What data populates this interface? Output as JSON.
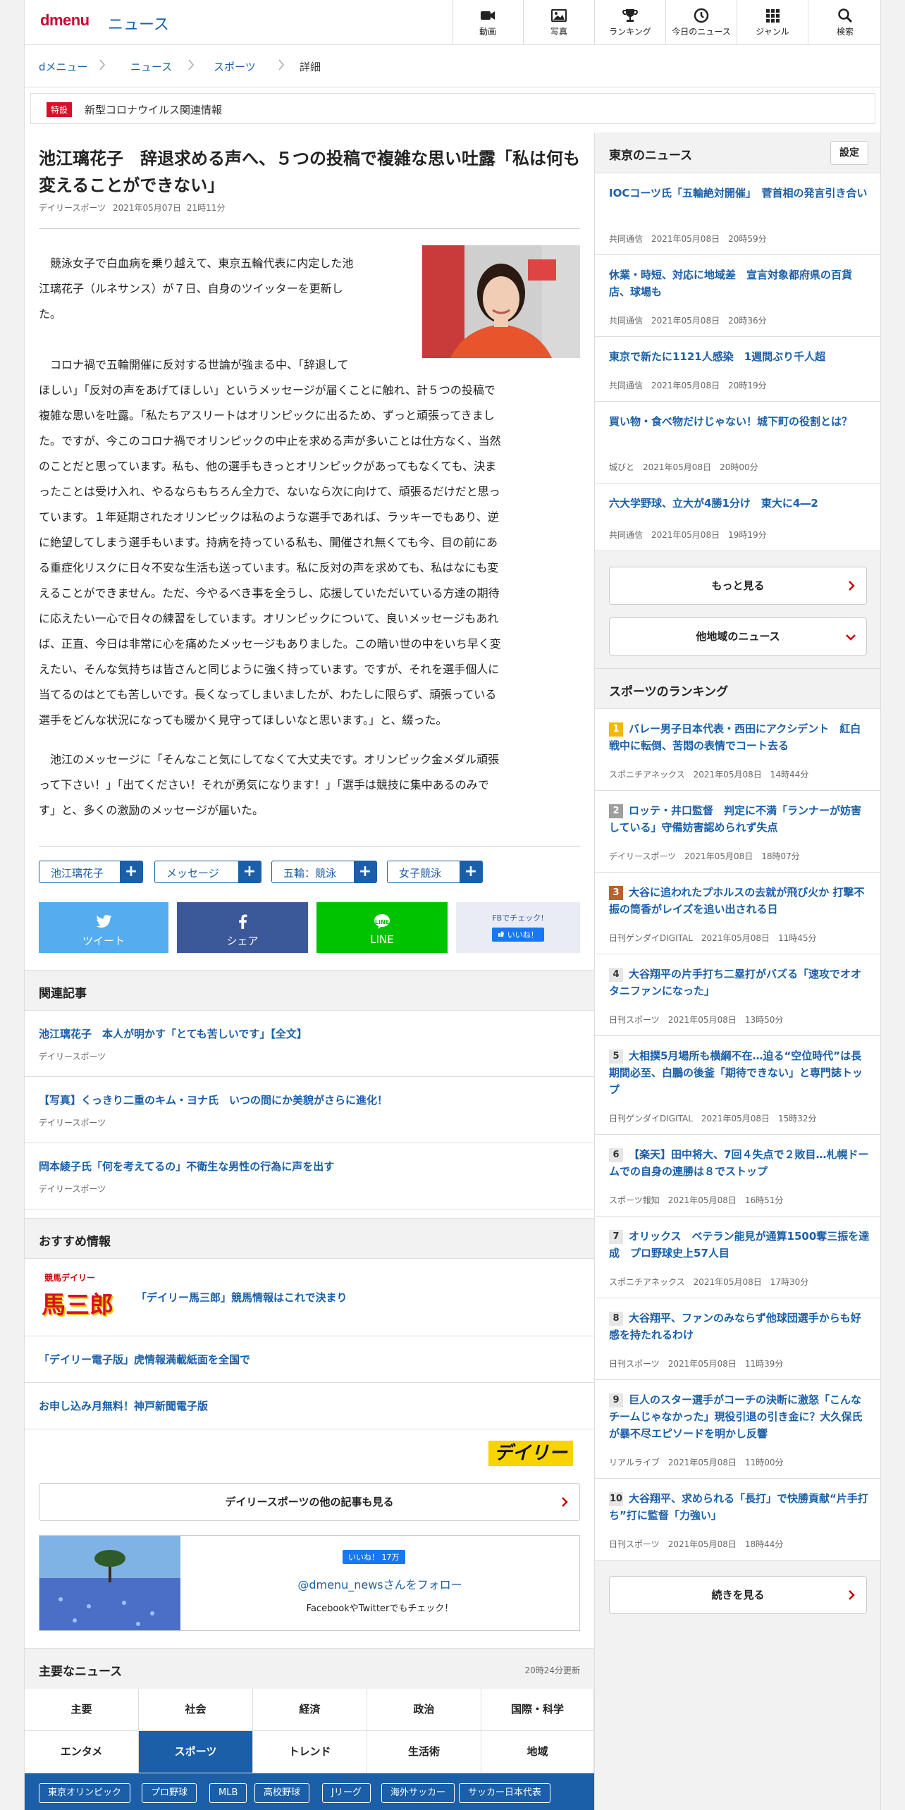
{
  "header": {
    "logo": "dmenu",
    "title": "ニュース",
    "nav": [
      "動画",
      "写真",
      "ランキング",
      "今日のニュース",
      "ジャンル",
      "検索"
    ]
  },
  "breadcrumb": [
    "dメニュー",
    "ニュース",
    "スポーツ",
    "詳細"
  ],
  "special": {
    "tag": "特設",
    "text": "新型コロナウイルス関連情報"
  },
  "article": {
    "title": "池江璃花子　辞退求める声へ、５つの投稿で複雑な思い吐露「私は何も変えることができない」",
    "source": "デイリースポーツ",
    "date": "2021年05月07日",
    "time": "21時11分",
    "paragraphs": [
      [
        "競泳女子で白血病を乗り越えて、東京五輪代表に内定した池",
        "江璃花子（ルネサンス）が７日、自身のツイッターを更新し",
        "た。"
      ],
      [
        "コロナ禍で五輪開催に反対する世論が強まる中、「辞退して",
        "ほしい」「反対の声をあげてほしい」というメッセージが届くことに触れ、計５つの投稿で",
        "複雑な思いを吐露。「私たちアスリートはオリンピックに出るため、ずっと頑張ってきまし",
        "た。ですが、今このコロナ禍でオリンピックの中止を求める声が多いことは仕方なく、当然",
        "のことだと思っています。私も、他の選手もきっとオリンピックがあってもなくても、決ま",
        "ったことは受け入れ、やるならもちろん全力で、ないなら次に向けて、頑張るだけだと思っ",
        "ています。１年延期されたオリンピックは私のような選手であれば、ラッキーでもあり、逆",
        "に絶望してしまう選手もいます。持病を持っている私も、開催され無くても今、目の前にあ",
        "る重症化リスクに日々不安な生活も送っています。私に反対の声を求めても、私はなにも変",
        "えることができません。ただ、今やるべき事を全うし、応援していただいている方達の期待",
        "に応えたい一心で日々の練習をしています。オリンピックについて、良いメッセージもあれ",
        "ば、正直、今日は非常に心を痛めたメッセージもありました。この暗い世の中をいち早く変",
        "えたい、そんな気持ちは皆さんと同じように強く持っています。ですが、それを選手個人に",
        "当てるのはとても苦しいです。長くなってしまいましたが、わたしに限らず、頑張っている",
        "選手をどんな状況になっても暖かく見守ってほしいなと思います。」と、綴った。"
      ],
      [
        "池江のメッセージに「そんなこと気にしてなくて大丈夫です。オリンピック金メダル頑張",
        "って下さい！」「出てください！それが勇気になります！」「選手は競技に集中あるのみで",
        "す」と、多くの激励のメッセージが届いた。"
      ]
    ],
    "tags": [
      "池江璃花子",
      "メッセージ",
      "五輪：競泳",
      "女子競泳"
    ],
    "tag_plus": "+",
    "share": {
      "twitter": "ツイート",
      "facebook": "シェア",
      "line": "LINE",
      "line_logo": "LINE",
      "fb_check": "FBでチェック!",
      "like": "いいね！"
    }
  },
  "related": {
    "heading": "関連記事",
    "items": [
      {
        "title": "池江璃花子　本人が明かす「とても苦しいです」【全文】",
        "source": "デイリースポーツ"
      },
      {
        "title": "【写真】くっきり二重のキム・ヨナ氏　いつの間にか美貌がさらに進化！",
        "source": "デイリースポーツ"
      },
      {
        "title": "岡本綾子氏「何を考えてるの」不衛生な男性の行為に声を出す",
        "source": "デイリースポーツ"
      }
    ]
  },
  "recommended": {
    "heading": "おすすめ情報",
    "items": [
      {
        "title": "「デイリー馬三郎」競馬情報はこれで決まり",
        "logo_top": "競馬デイリー",
        "logo_main": "馬三郎"
      },
      {
        "title": "「デイリー電子版」虎情報満載紙面を全国で"
      },
      {
        "title": "お申し込み月無料！神戸新聞電子版"
      }
    ],
    "brand": "デイリー",
    "more_label": "デイリースポーツの他の記事も見る"
  },
  "follow": {
    "like_label": "いいね！ 17万",
    "account": "@dmenu_newsさんをフォロー",
    "sub": "FacebookやTwitterでもチェック！"
  },
  "main_news": {
    "heading": "主要なニュース",
    "updated": "20時24分更新",
    "categories": [
      "主要",
      "社会",
      "経済",
      "政治",
      "国際・科学",
      "エンタメ",
      "スポーツ",
      "トレンド",
      "生活術",
      "地域"
    ],
    "active": "スポーツ",
    "subcategories": [
      "東京オリンピック",
      "プロ野球",
      "MLB",
      "高校野球",
      "Jリーグ",
      "海外サッカー",
      "サッカー日本代表"
    ]
  },
  "sidebar": {
    "local_heading": "東京のニュース",
    "settings_label": "設定",
    "local_items": [
      {
        "title": "IOCコーツ氏「五輪絶対開催」　菅首相の発言引き合い",
        "source": "共同通信",
        "date": "2021年05月08日",
        "time": "20時59分"
      },
      {
        "title": "休業・時短、対応に地域差　宣言対象都府県の百貨店、球場も",
        "source": "共同通信",
        "date": "2021年05月08日",
        "time": "20時36分"
      },
      {
        "title": "東京で新たに1121人感染　1週間ぶり千人超",
        "source": "共同通信",
        "date": "2021年05月08日",
        "time": "20時19分"
      },
      {
        "title": "買い物・食べ物だけじゃない！城下町の役割とは？",
        "source": "城びと",
        "date": "2021年05月08日",
        "time": "20時00分"
      },
      {
        "title": "六大学野球、立大が4勝1分け　東大に4―2",
        "source": "共同通信",
        "date": "2021年05月08日",
        "time": "19時19分"
      }
    ],
    "more_label": "もっと見る",
    "other_regions": "他地域のニュース",
    "ranking_heading": "スポーツのランキング",
    "ranking": [
      {
        "rank": "1",
        "title": "バレー男子日本代表・西田にアクシデント　紅白戦中に転倒、苦悶の表情でコート去る",
        "source": "スポニチアネックス",
        "date": "2021年05月08日",
        "time": "14時44分",
        "color": "#f5b800"
      },
      {
        "rank": "2",
        "title": "ロッテ・井口監督　判定に不満「ランナーが妨害している」守備妨害認められず失点",
        "source": "デイリースポーツ",
        "date": "2021年05月08日",
        "time": "18時07分",
        "color": "#9e9e9e"
      },
      {
        "rank": "3",
        "title": "大谷に追われたプホルスの去就が飛び火か 打撃不振の筒香がレイズを追い出される日",
        "source": "日刊ゲンダイDIGITAL",
        "date": "2021年05月08日",
        "time": "11時45分",
        "color": "#b8632b"
      },
      {
        "rank": "4",
        "title": "大谷翔平の片手打ち二塁打がバズる「速攻でオオタニファンになった」",
        "source": "日刊スポーツ",
        "date": "2021年05月08日",
        "time": "13時50分",
        "color": "#e6e6e6"
      },
      {
        "rank": "5",
        "title": "大相撲5月場所も横綱不在…迫る“空位時代”は長期間必至、白鵬の後釜「期待できない」と専門誌トップ",
        "source": "日刊ゲンダイDIGITAL",
        "date": "2021年05月08日",
        "time": "15時32分",
        "color": "#e6e6e6"
      },
      {
        "rank": "6",
        "title": "【楽天】田中将大、7回４失点で２敗目…札幌ドームでの自身の連勝は８でストップ",
        "source": "スポーツ報知",
        "date": "2021年05月08日",
        "time": "16時51分",
        "color": "#e6e6e6"
      },
      {
        "rank": "7",
        "title": "オリックス　ベテラン能見が通算1500奪三振を達成　プロ野球史上57人目",
        "source": "スポニチアネックス",
        "date": "2021年05月08日",
        "time": "17時30分",
        "color": "#e6e6e6"
      },
      {
        "rank": "8",
        "title": "大谷翔平、ファンのみならず他球団選手からも好感を持たれるわけ",
        "source": "日刊スポーツ",
        "date": "2021年05月08日",
        "time": "11時39分",
        "color": "#e6e6e6"
      },
      {
        "rank": "9",
        "title": "巨人のスター選手がコーチの決断に激怒「こんなチームじゃなかった」現役引退の引き金に？大久保氏が暴不尽エピソードを明かし反響",
        "source": "リアルライブ",
        "date": "2021年05月08日",
        "time": "11時00分",
        "color": "#e6e6e6"
      },
      {
        "rank": "10",
        "title": "大谷翔平、求められる「長打」で快勝貢献“片手打ち”打に監督「力強い」",
        "source": "日刊スポーツ",
        "date": "2021年05月08日",
        "time": "18時44分",
        "color": "#e6e6e6"
      }
    ],
    "ranking_more": "続きを見る"
  }
}
